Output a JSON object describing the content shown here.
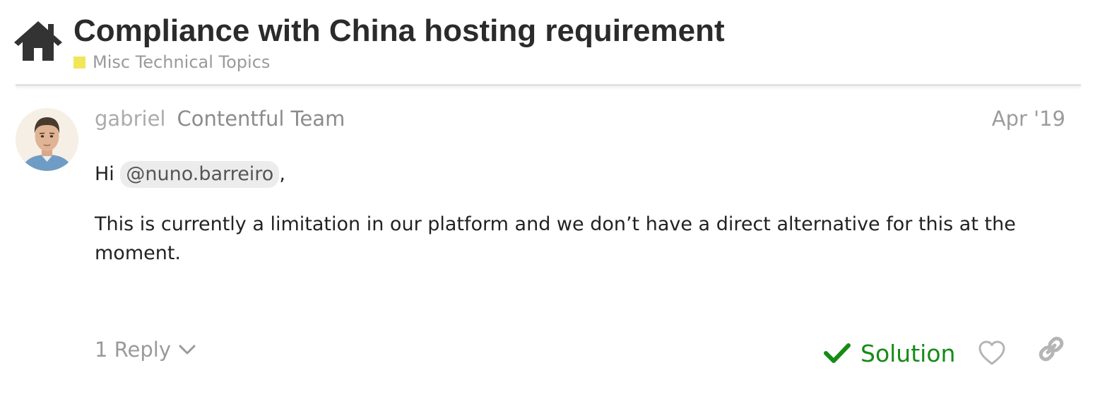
{
  "header": {
    "title": "Compliance with China hosting requirement",
    "category": "Misc Technical Topics",
    "category_color": "#F1E65A",
    "home_icon": "home-icon"
  },
  "post": {
    "username": "gabriel",
    "user_title": "Contentful Team",
    "date": "Apr '19",
    "greeting": "Hi",
    "mention": "@nuno.barreiro",
    "greeting_suffix": ",",
    "body": "This is currently a limitation in our platform and we don’t have a direct alternative for this at the moment."
  },
  "footer": {
    "replies_label": "1 Reply",
    "solution_label": "Solution",
    "solution_color": "#168b16",
    "icons": [
      "chevron-down-icon",
      "check-icon",
      "heart-icon",
      "link-icon"
    ]
  }
}
